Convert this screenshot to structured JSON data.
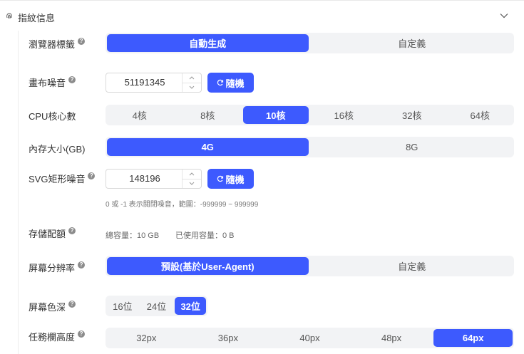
{
  "section": {
    "title": "指紋信息"
  },
  "ua_tag": {
    "label": "瀏覽器標籤",
    "options": [
      "自動生成",
      "自定義"
    ],
    "selected": 0
  },
  "canvas_noise": {
    "label": "畫布噪音",
    "value": "51191345",
    "random_label": "隨機"
  },
  "cpu": {
    "label": "CPU核心數",
    "options": [
      "4核",
      "8核",
      "10核",
      "16核",
      "32核",
      "64核"
    ],
    "selected": 2
  },
  "memory": {
    "label": "內存大小(GB)",
    "options": [
      "4G",
      "8G"
    ],
    "selected": 0
  },
  "svg_noise": {
    "label": "SVG矩形噪音",
    "value": "148196",
    "random_label": "隨機",
    "hint": "0 或 -1 表示關閉噪音，範圍：-999999 ~ 999999"
  },
  "storage": {
    "label": "存儲配額",
    "total": "總容量：10 GB",
    "used": "已使用容量：0 B"
  },
  "resolution": {
    "label": "屏幕分辨率",
    "options": [
      "預設(基於User-Agent)",
      "自定義"
    ],
    "selected": 0
  },
  "color_depth": {
    "label": "屏幕色深",
    "options": [
      "16位",
      "24位",
      "32位"
    ],
    "selected": 2
  },
  "taskbar": {
    "label": "任務欄高度",
    "options": [
      "32px",
      "36px",
      "40px",
      "48px",
      "64px"
    ],
    "selected": 4
  },
  "colors": {
    "accent": "#3d5afe",
    "segment_bg": "#f2f3f5"
  }
}
